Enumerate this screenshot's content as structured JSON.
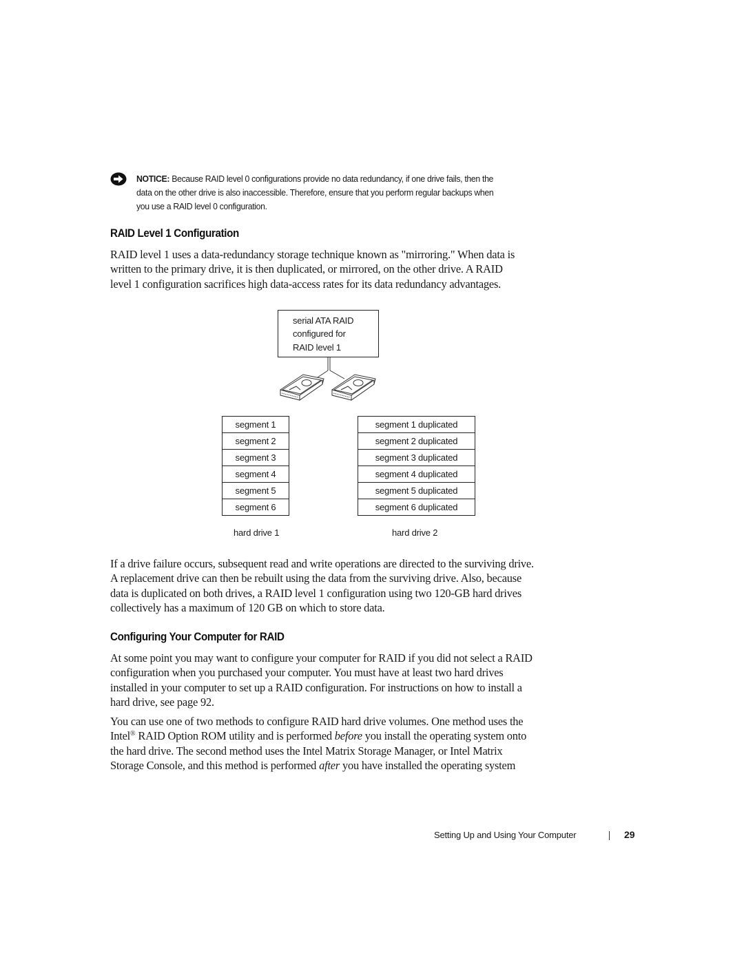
{
  "notice": {
    "icon": "notice-arrow-icon",
    "label": "NOTICE:",
    "text": " Because RAID level 0 configurations provide no data redundancy, if one drive fails, then the data on the other drive is also inaccessible. Therefore, ensure that you perform regular backups when you use a RAID level 0 configuration.",
    "lines": [
      " Because RAID level 0 configurations provide no data redundancy, if one drive fails, then the",
      "data on the other drive is also inaccessible. Therefore, ensure that you perform regular backups when",
      "you use a RAID level 0 configuration."
    ]
  },
  "section1": {
    "heading": "RAID Level 1 Configuration",
    "paragraph_lines": [
      "RAID level 1 uses a data-redundancy storage technique known as \"mirroring.\" When data is",
      "written to the primary drive, it is then duplicated, or mirrored, on the other drive. A RAID",
      "level 1 configuration sacrifices high data-access rates for its data redundancy advantages."
    ]
  },
  "diagram": {
    "controller_lines": [
      "serial ATA RAID",
      "configured for",
      "RAID level 1"
    ],
    "drive1": {
      "label": "hard drive 1",
      "segments": [
        "segment 1",
        "segment 2",
        "segment 3",
        "segment 4",
        "segment 5",
        "segment 6"
      ]
    },
    "drive2": {
      "label": "hard drive 2",
      "segments": [
        "segment 1 duplicated",
        "segment 2 duplicated",
        "segment 3 duplicated",
        "segment 4 duplicated",
        "segment 5 duplicated",
        "segment 6 duplicated"
      ]
    }
  },
  "paragraph2_lines": [
    "If a drive failure occurs, subsequent read and write operations are directed to the surviving drive.",
    "A replacement drive can then be rebuilt using the data from the surviving drive. Also, because",
    "data is duplicated on both drives, a RAID level 1 configuration using two 120-GB hard drives",
    "collectively has a maximum of 120 GB on which to store data."
  ],
  "section2": {
    "heading": "Configuring Your Computer for RAID",
    "paragraph1_lines": [
      "At some point you may want to configure your computer for RAID if you did not select a RAID",
      "configuration when you purchased your computer. You must have at least two hard drives",
      "installed in your computer to set up a RAID configuration. For instructions on how to install a",
      "hard drive, see page 92."
    ],
    "paragraph2": {
      "line1": "You can use one of two methods to configure RAID hard drive volumes. One method uses the",
      "line2_a": "Intel",
      "line2_reg": "®",
      "line2_b": " RAID Option ROM utility and is performed ",
      "line2_em": "before",
      "line2_c": " you install the operating system onto",
      "line3": "the hard drive. The second method uses the Intel Matrix Storage Manager, or Intel Matrix",
      "line4_a": "Storage Console, and this method is performed ",
      "line4_em": "after",
      "line4_b": " you have installed the operating system"
    }
  },
  "footer": {
    "section_title": "Setting Up and Using Your Computer",
    "page_number": "29"
  }
}
